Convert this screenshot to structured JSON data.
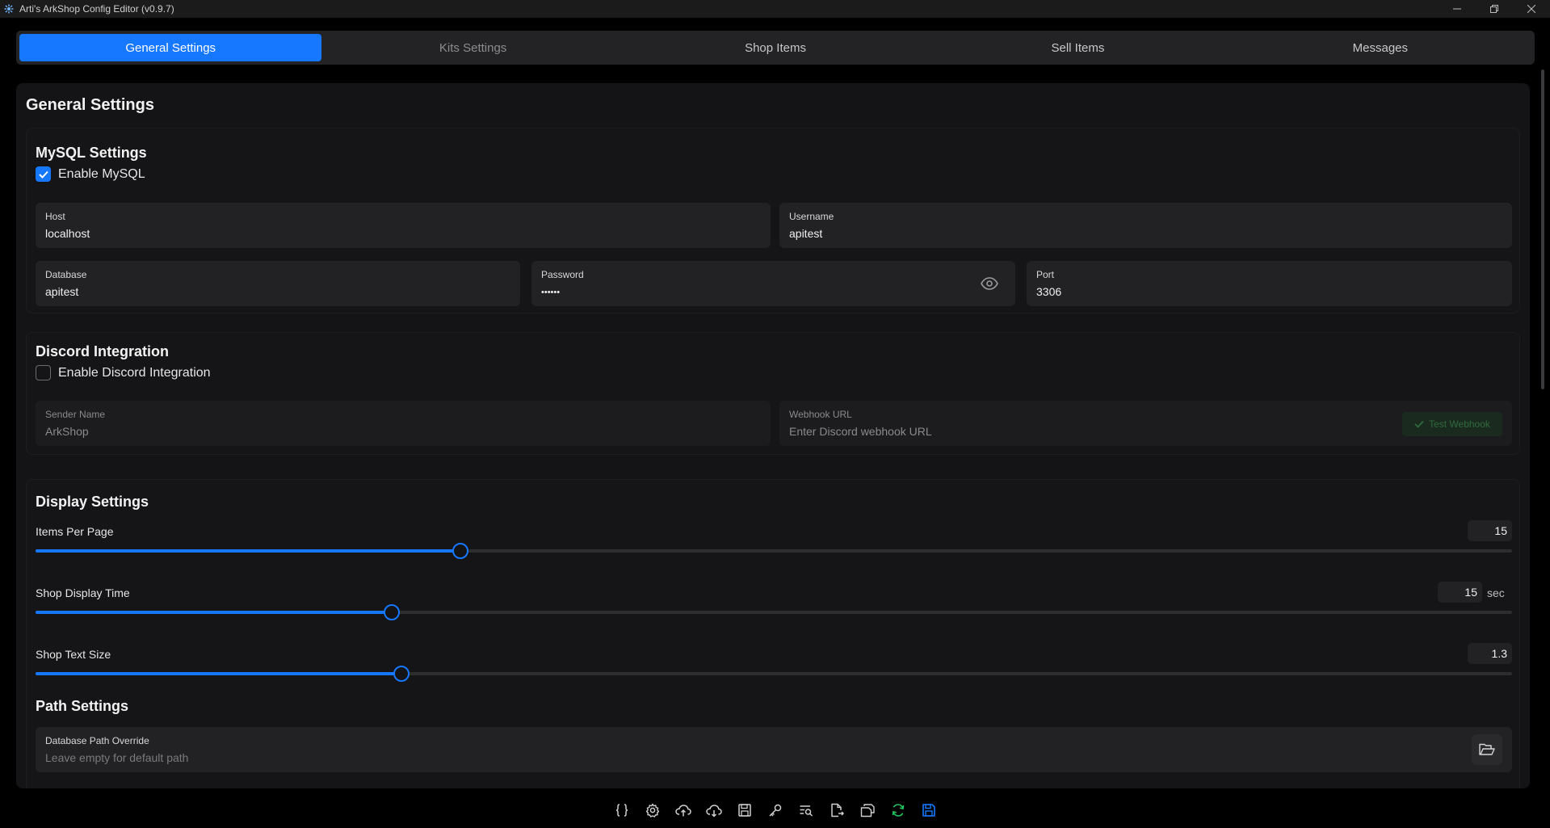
{
  "window": {
    "title": "Arti's ArkShop Config Editor (v0.9.7)",
    "controls": [
      "minimize",
      "restore",
      "close"
    ]
  },
  "tabs": [
    {
      "label": "General Settings",
      "active": true
    },
    {
      "label": "Kits Settings",
      "active": false
    },
    {
      "label": "Shop Items",
      "active": false
    },
    {
      "label": "Sell Items",
      "active": false
    },
    {
      "label": "Messages",
      "active": false
    }
  ],
  "page": {
    "title": "General Settings"
  },
  "mysql": {
    "title": "MySQL Settings",
    "enable_label": "Enable MySQL",
    "enabled": true,
    "host_label": "Host",
    "host_value": "localhost",
    "username_label": "Username",
    "username_value": "apitest",
    "database_label": "Database",
    "database_value": "apitest",
    "password_label": "Password",
    "password_value": "••••••",
    "port_label": "Port",
    "port_value": "3306"
  },
  "discord": {
    "title": "Discord Integration",
    "enable_label": "Enable Discord Integration",
    "enabled": false,
    "sender_label": "Sender Name",
    "sender_value": "ArkShop",
    "webhook_label": "Webhook URL",
    "webhook_placeholder": "Enter Discord webhook URL",
    "test_button": "Test Webhook"
  },
  "display": {
    "title": "Display Settings",
    "items_per_page_label": "Items Per Page",
    "items_per_page_value": "15",
    "items_per_page_fraction": 0.288,
    "shop_display_time_label": "Shop Display Time",
    "shop_display_time_value": "15",
    "shop_display_time_unit": "sec",
    "shop_display_time_fraction": 0.241,
    "shop_text_size_label": "Shop Text Size",
    "shop_text_size_value": "1.3",
    "shop_text_size_fraction": 0.248
  },
  "paths": {
    "title": "Path Settings",
    "db_path_label": "Database Path Override",
    "db_path_placeholder": "Leave empty for default path"
  },
  "toolbar": {
    "icons": [
      "braces-icon",
      "gear-icon",
      "cloud-upload-icon",
      "cloud-download-icon",
      "save-disk-icon",
      "key-icon",
      "search-list-icon",
      "file-export-icon",
      "copy-files-icon",
      "sync-icon",
      "save-icon"
    ]
  },
  "colors": {
    "accent": "#1677ff",
    "sync": "#22c55e"
  }
}
